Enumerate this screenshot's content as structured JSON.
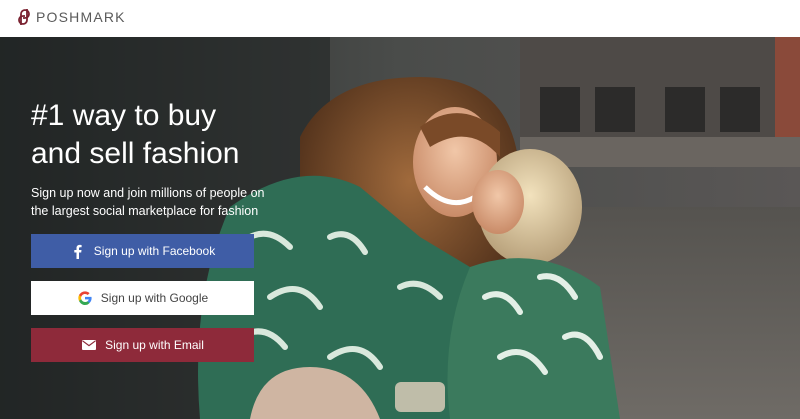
{
  "header": {
    "brand": "POSHMARK"
  },
  "hero": {
    "headline_line1": "#1 way to buy",
    "headline_line2": "and sell fashion",
    "subtext_line1": "Sign up now and join millions of people on",
    "subtext_line2": "the largest social marketplace for fashion"
  },
  "buttons": {
    "facebook_label": "Sign up with Facebook",
    "google_label": "Sign up with Google",
    "email_label": "Sign up with Email"
  },
  "colors": {
    "facebook": "#3f5da6",
    "google": "#ffffff",
    "email": "#8e2a3a",
    "brand": "#7a2130"
  },
  "icons": [
    "poshmark-logo-icon",
    "facebook-icon",
    "google-icon",
    "email-icon"
  ]
}
